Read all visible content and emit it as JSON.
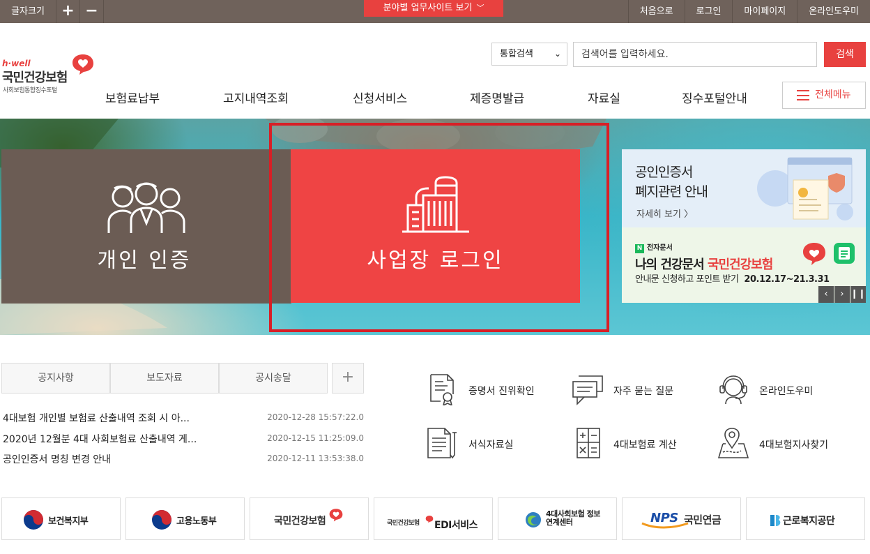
{
  "topbar": {
    "font_size_label": "글자크기",
    "plus": "+",
    "minus": "−",
    "site_dropdown": "분야별 업무사이트 보기",
    "links": [
      "처음으로",
      "로그인",
      "마이페이지",
      "온라인도우미"
    ]
  },
  "logo": {
    "hwell": "h·well",
    "name": "국민건강보험",
    "sub": "사회보험통합징수포털"
  },
  "search": {
    "select_value": "통합검색",
    "placeholder": "검색어를 입력하세요.",
    "button": "검색"
  },
  "gnb": [
    "보험료납부",
    "고지내역조회",
    "신청서비스",
    "제증명발급",
    "자료실",
    "징수포털안내"
  ],
  "all_menu": "전체메뉴",
  "hero": {
    "personal_label": "개인 인증",
    "business_label": "사업장 로그인"
  },
  "banner1": {
    "line1": "공인인증서",
    "line2": "폐지관련 안내",
    "more": "자세히 보기 〉"
  },
  "banner2": {
    "badge": "N",
    "tag": "전자문서",
    "title_prefix": "나의 건강문서",
    "title_brand": "국민건강보험",
    "sub": "안내문 신청하고 포인트 받기",
    "period": "20.12.17~21.3.31"
  },
  "slider_controls": [
    "‹",
    "›",
    "❙❙"
  ],
  "notice_tabs": [
    "공지사항",
    "보도자료",
    "공시송달"
  ],
  "notice_more": "+",
  "notices": [
    {
      "title": "4대보험 개인별 보험료 산출내역 조회 시 아...",
      "date": "2020-12-28 15:57:22.0"
    },
    {
      "title": "2020년 12월분 4대 사회보험료 산출내역 게...",
      "date": "2020-12-15 11:25:09.0"
    },
    {
      "title": "공인인증서 명칭 변경 안내",
      "date": "2020-12-11 13:53:38.0"
    }
  ],
  "quick_menu": [
    {
      "label": "증명서 진위확인",
      "icon": "certificate-icon"
    },
    {
      "label": "자주 묻는 질문",
      "icon": "chat-icon"
    },
    {
      "label": "온라인도우미",
      "icon": "headset-icon"
    },
    {
      "label": "서식자료실",
      "icon": "document-icon"
    },
    {
      "label": "4대보험료 계산",
      "icon": "calculator-icon"
    },
    {
      "label": "4대보험지사찾기",
      "icon": "map-pin-icon"
    }
  ],
  "footer_links": [
    {
      "label": "보건복지부"
    },
    {
      "label": "고용노동부"
    },
    {
      "label": "국민건강보험"
    },
    {
      "label": "EDI서비스"
    },
    {
      "label": "4대사회보험 정보연계센터"
    },
    {
      "label": "국민연금"
    },
    {
      "label": "근로복지공단"
    }
  ],
  "footer_sublabels": {
    "nps": "NPS",
    "edi_brand": "국민건강보험"
  },
  "colors": {
    "accent": "#e8413f",
    "topbar": "#6f625b",
    "personal_panel": "#6b5c54",
    "business_panel": "#ef4444",
    "highlight": "#d81f26"
  }
}
